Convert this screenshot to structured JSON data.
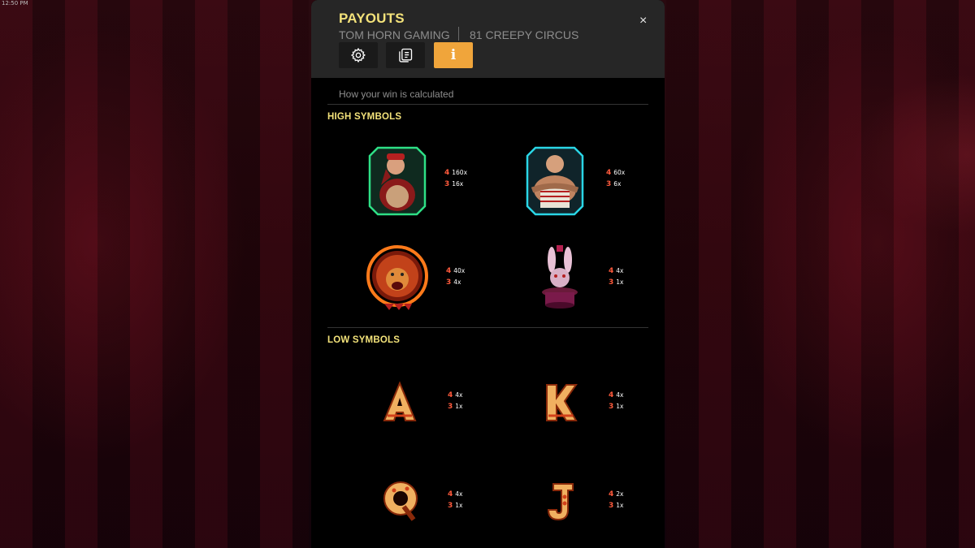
{
  "status_bar": {
    "clock": "12:50 PM"
  },
  "header": {
    "title": "PAYOUTS",
    "provider": "TOM HORN GAMING",
    "game": "81 CREEPY CIRCUS",
    "close_icon": "×",
    "tabs": [
      {
        "icon": "gear-icon",
        "active": false
      },
      {
        "icon": "paytable-icon",
        "active": false
      },
      {
        "icon": "info-icon",
        "glyph": "i",
        "active": true
      }
    ]
  },
  "section_caption": "How your win is calculated",
  "high_symbols": {
    "heading": "HIGH SYMBOLS",
    "items": [
      {
        "symbol": "ringmaster",
        "pays": [
          {
            "count": "4",
            "value": "160x"
          },
          {
            "count": "3",
            "value": "16x"
          }
        ]
      },
      {
        "symbol": "strongman",
        "pays": [
          {
            "count": "4",
            "value": "60x"
          },
          {
            "count": "3",
            "value": "6x"
          }
        ]
      },
      {
        "symbol": "lion",
        "pays": [
          {
            "count": "4",
            "value": "40x"
          },
          {
            "count": "3",
            "value": "4x"
          }
        ]
      },
      {
        "symbol": "rabbit",
        "pays": [
          {
            "count": "4",
            "value": "4x"
          },
          {
            "count": "3",
            "value": "1x"
          }
        ]
      }
    ]
  },
  "low_symbols": {
    "heading": "LOW SYMBOLS",
    "items": [
      {
        "symbol": "A",
        "pays": [
          {
            "count": "4",
            "value": "4x"
          },
          {
            "count": "3",
            "value": "1x"
          }
        ]
      },
      {
        "symbol": "K",
        "pays": [
          {
            "count": "4",
            "value": "4x"
          },
          {
            "count": "3",
            "value": "1x"
          }
        ]
      },
      {
        "symbol": "Q",
        "pays": [
          {
            "count": "4",
            "value": "4x"
          },
          {
            "count": "3",
            "value": "1x"
          }
        ]
      },
      {
        "symbol": "J",
        "pays": [
          {
            "count": "4",
            "value": "2x"
          },
          {
            "count": "3",
            "value": "1x"
          }
        ]
      }
    ]
  },
  "colors": {
    "accent": "#f0a53b",
    "heading": "#f3e27a",
    "pay_count": "#ff5a3c",
    "panel": "#000000",
    "header": "#262626"
  }
}
